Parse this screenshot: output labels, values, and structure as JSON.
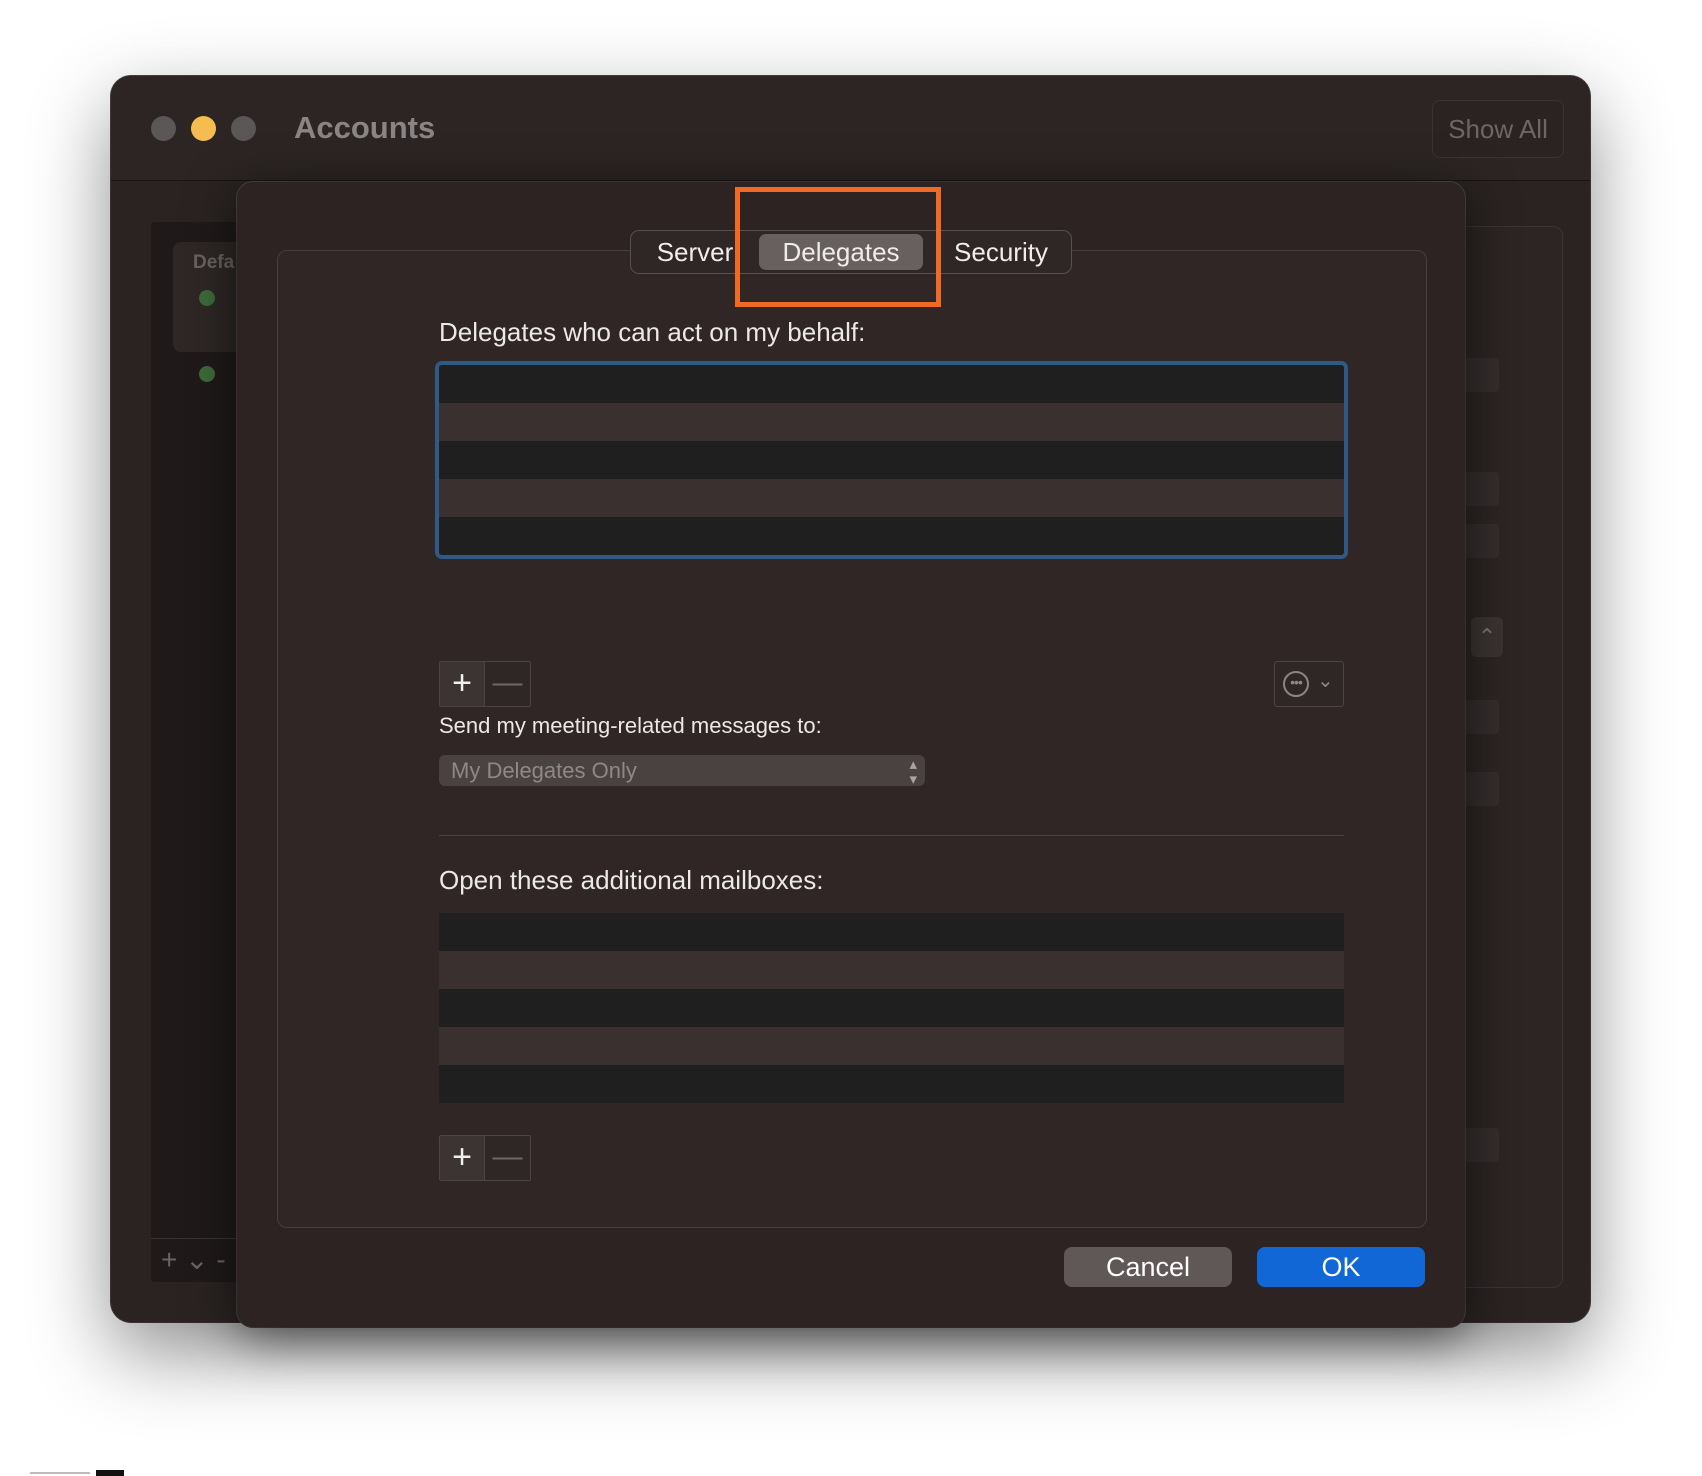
{
  "window": {
    "title": "Accounts",
    "show_all_label": "Show All",
    "sidebar": {
      "default_label": "Defa",
      "footer_controls": "+ ⌄   -"
    }
  },
  "dialog": {
    "tabs": [
      {
        "label": "Server"
      },
      {
        "label": "Delegates",
        "selected": true
      },
      {
        "label": "Security"
      }
    ],
    "delegates_label": "Delegates who can act on my behalf:",
    "delegates_rows": 5,
    "add_icon": "+",
    "remove_icon": "—",
    "action_menu_chevron": "⌄",
    "meeting_label": "Send my meeting-related messages to:",
    "meeting_select": {
      "selected": "My Delegates Only"
    },
    "mailboxes_label": "Open these additional mailboxes:",
    "mailboxes_rows": 5,
    "cancel_label": "Cancel",
    "ok_label": "OK"
  },
  "colors": {
    "highlight": "#ef6a24",
    "ok_button": "#1267d6",
    "focus_ring": "#2f5a86"
  }
}
